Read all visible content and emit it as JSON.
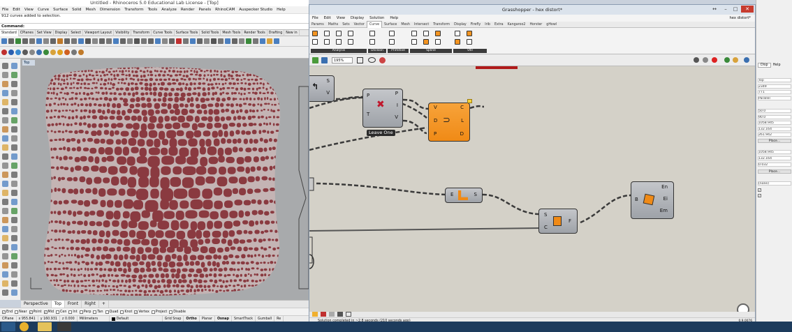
{
  "rhino": {
    "title": "Untitled - Rhinoceros 5.0 Educational Lab License - [Top]",
    "menu": [
      "File",
      "Edit",
      "View",
      "Curve",
      "Surface",
      "Solid",
      "Mesh",
      "Dimension",
      "Transform",
      "Tools",
      "Analyze",
      "Render",
      "Panels",
      "RhinoCAM",
      "Auspecker Studio",
      "Help"
    ],
    "command_history": "912 curves added to selection.",
    "command_prompt": "Command:",
    "toolbar_tabs": [
      "Standard",
      "CPlanes",
      "Set View",
      "Display",
      "Select",
      "Viewport Layout",
      "Visibility",
      "Transform",
      "Curve Tools",
      "Surface Tools",
      "Solid Tools",
      "Mesh Tools",
      "Render Tools",
      "Drafting",
      "New in"
    ],
    "viewport_label": "Top",
    "viewport_tabs": [
      "Perspective",
      "Top",
      "Front",
      "Right"
    ],
    "viewport_add": "+",
    "osnaps": [
      {
        "label": "End",
        "checked": true
      },
      {
        "label": "Near",
        "checked": false
      },
      {
        "label": "Point",
        "checked": true
      },
      {
        "label": "Mid",
        "checked": true
      },
      {
        "label": "Cen",
        "checked": false
      },
      {
        "label": "Int",
        "checked": false
      },
      {
        "label": "Perp",
        "checked": false
      },
      {
        "label": "Tan",
        "checked": false
      },
      {
        "label": "Quad",
        "checked": false
      },
      {
        "label": "Knot",
        "checked": false
      },
      {
        "label": "Vertex",
        "checked": true
      },
      {
        "label": "Project",
        "checked": false
      },
      {
        "label": "Disable",
        "checked": false
      }
    ],
    "status": {
      "cplane": "CPlane",
      "x": "x 955.841",
      "y": "y 160.931",
      "z": "z 0.000",
      "units": "Millimeters",
      "layer": "Default",
      "grid_snap": "Grid Snap",
      "ortho": "Ortho",
      "planar": "Planar",
      "osnap": "Osnap",
      "smarttrack": "SmartTrack",
      "gumball": "Gumball",
      "record": "Re"
    },
    "cell_color": "#8a3a40",
    "cell_gap_color": "#c8b9b9"
  },
  "grasshopper": {
    "title": "Grasshopper - hex distort*",
    "filename": "hex distort*",
    "menu": [
      "File",
      "Edit",
      "View",
      "Display",
      "Solution",
      "Help"
    ],
    "tabs": [
      "Params",
      "Maths",
      "Sets",
      "Vector",
      "Curve",
      "Surface",
      "Mesh",
      "Intersect",
      "Transform",
      "Display",
      "Firefly",
      "Irib",
      "Extra",
      "Kangaroo2",
      "Horster",
      "gHowl"
    ],
    "active_tab": "Curve",
    "ribbon_groups": [
      "Analysis",
      "Division",
      "Primitive",
      "Spline",
      "Util"
    ],
    "zoom": "195%",
    "status": "Solution completed in ~2.8 seconds (210 seconds ago)",
    "version": "0.9.0076",
    "components": {
      "partial_left": {
        "ports_out": [
          "S",
          "V"
        ]
      },
      "leave_one": {
        "label": "Leave One",
        "ports_in": [
          "P",
          "T"
        ],
        "ports_out": [
          "P",
          "I",
          "V"
        ]
      },
      "orange": {
        "ports_in": [
          "V",
          "D",
          "P"
        ],
        "ports_out": [
          "C",
          "L",
          "D"
        ]
      },
      "edge_srf": {
        "ports_in": [
          "E"
        ],
        "ports_out": [
          "S"
        ]
      },
      "extrude": {
        "ports_in": [
          "S",
          "C"
        ],
        "ports_out": [
          "F"
        ]
      },
      "brep_edges": {
        "ports_in": [
          "B"
        ],
        "ports_out": [
          "En",
          "Ei",
          "Em"
        ]
      }
    }
  },
  "right_panel": {
    "tabs": [
      "Disp",
      "Help"
    ],
    "fields": [
      "Top",
      "2349",
      "771",
      "Parallel",
      "50.0",
      "90.0",
      "1058.945",
      "132.164",
      "261.942",
      "Place...",
      "1058.945",
      "132.164",
      "0.032",
      "Place...",
      "(none)"
    ]
  },
  "colors": {
    "gh_orange": "#f39421",
    "gh_canvas": "#d4d1c8",
    "close_red": "#c73b2e",
    "taskbar": "#1d3b5c"
  }
}
